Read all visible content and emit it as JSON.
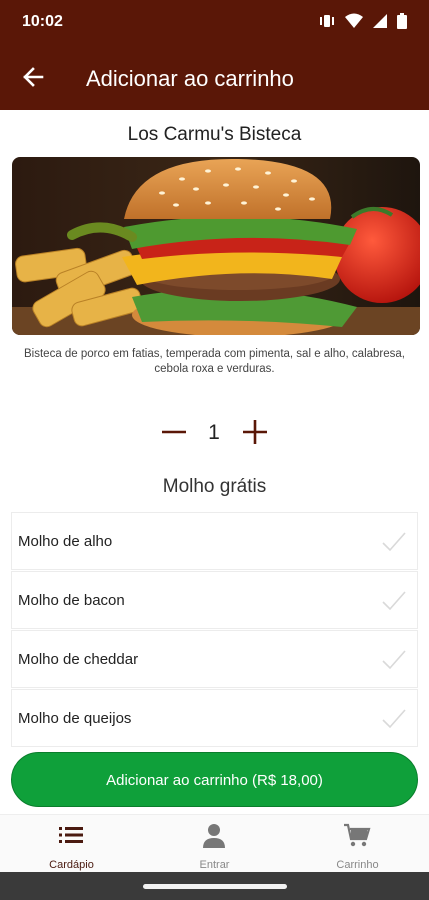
{
  "status_bar": {
    "time": "10:02"
  },
  "header": {
    "title": "Adicionar ao carrinho"
  },
  "product": {
    "name": "Los Carmu's Bisteca",
    "description": "Bisteca de porco em fatias, temperada com pimenta, sal e alho, calabresa, cebola roxa e verduras.",
    "quantity": "1"
  },
  "sauces": {
    "title": "Molho grátis",
    "items": [
      {
        "label": "Molho de alho"
      },
      {
        "label": "Molho de bacon"
      },
      {
        "label": "Molho de cheddar"
      },
      {
        "label": "Molho de queijos"
      }
    ]
  },
  "add_button": {
    "label": "Adicionar ao carrinho (R$ 18,00)"
  },
  "bottom_nav": {
    "items": [
      {
        "label": "Cardápio",
        "icon": "list-icon"
      },
      {
        "label": "Entrar",
        "icon": "person-icon"
      },
      {
        "label": "Carrinho",
        "icon": "cart-icon"
      }
    ]
  },
  "colors": {
    "header": "#5a1707",
    "accent": "#0fa03a",
    "quantity_controls": "#5a1707"
  }
}
